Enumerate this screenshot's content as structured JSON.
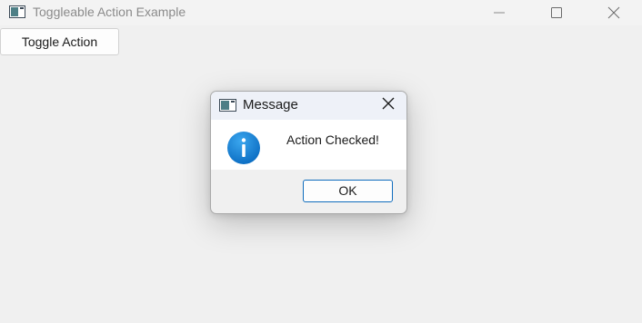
{
  "window": {
    "title": "Toggleable Action Example",
    "icon": "app-window-icon",
    "controls": [
      "minimize-icon",
      "maximize-icon",
      "close-icon"
    ]
  },
  "toolbar": {
    "toggle_label": "Toggle Action"
  },
  "dialog": {
    "title": "Message",
    "icon": "app-window-icon",
    "message_icon": "info-icon",
    "message": "Action Checked!",
    "ok_label": "OK"
  },
  "colors": {
    "background": "#f0f0f0",
    "info_blue": "#1a86d8",
    "accent_border": "#0f6cbd"
  }
}
